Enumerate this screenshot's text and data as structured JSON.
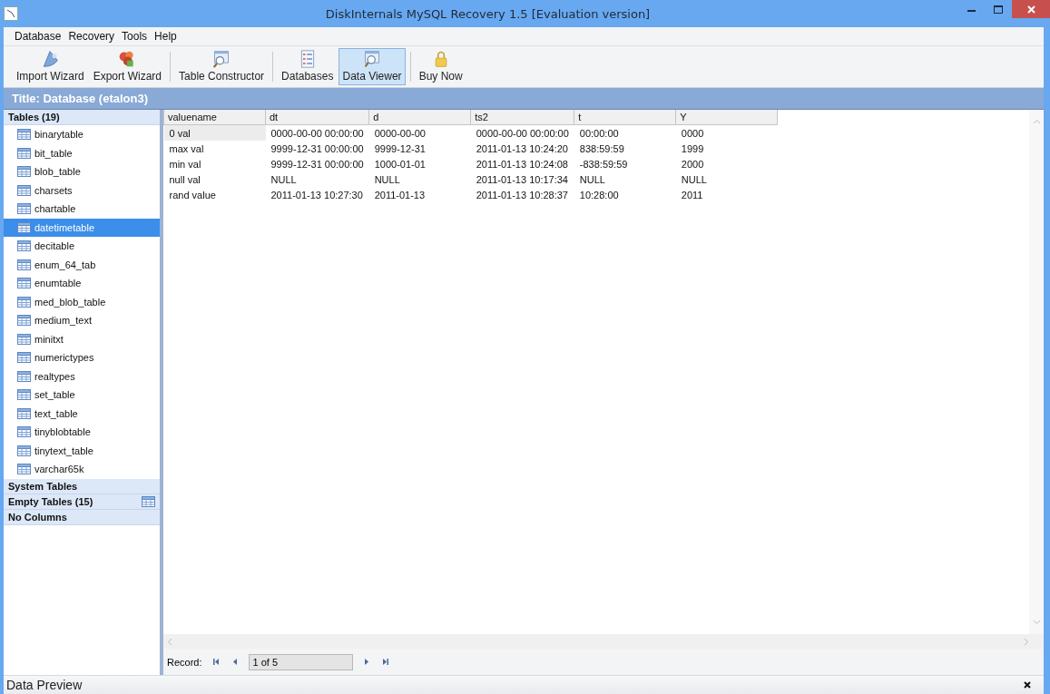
{
  "window": {
    "title": "DiskInternals MySQL Recovery 1.5 [Evaluation version]"
  },
  "menu": [
    "Database",
    "Recovery",
    "Tools",
    "Help"
  ],
  "toolbar": [
    {
      "label": "Import Wizard",
      "kind": "import",
      "selected": false,
      "separator_after": false
    },
    {
      "label": "Export Wizard",
      "kind": "export",
      "selected": false,
      "separator_after": true
    },
    {
      "label": "Table Constructor",
      "kind": "constructor",
      "selected": false,
      "separator_after": true
    },
    {
      "label": "Databases",
      "kind": "databases",
      "selected": false,
      "separator_after": false
    },
    {
      "label": "Data Viewer",
      "kind": "viewer",
      "selected": true,
      "separator_after": true
    },
    {
      "label": "Buy Now",
      "kind": "buy",
      "selected": false,
      "separator_after": false
    }
  ],
  "title_strip": "Title: Database (etalon3)",
  "sidebar": {
    "sections": [
      {
        "label": "Tables (19)",
        "table_icon": false,
        "items": [
          {
            "label": "binarytable",
            "selected": false
          },
          {
            "label": "bit_table",
            "selected": false
          },
          {
            "label": "blob_table",
            "selected": false
          },
          {
            "label": "charsets",
            "selected": false
          },
          {
            "label": "chartable",
            "selected": false
          },
          {
            "label": "datetimetable",
            "selected": true
          },
          {
            "label": "decitable",
            "selected": false
          },
          {
            "label": "enum_64_tab",
            "selected": false
          },
          {
            "label": "enumtable",
            "selected": false
          },
          {
            "label": "med_blob_table",
            "selected": false
          },
          {
            "label": "medium_text",
            "selected": false
          },
          {
            "label": "minitxt",
            "selected": false
          },
          {
            "label": "numerictypes",
            "selected": false
          },
          {
            "label": "realtypes",
            "selected": false
          },
          {
            "label": "set_table",
            "selected": false
          },
          {
            "label": "text_table",
            "selected": false
          },
          {
            "label": "tinyblobtable",
            "selected": false
          },
          {
            "label": "tinytext_table",
            "selected": false
          },
          {
            "label": "varchar65k",
            "selected": false
          }
        ]
      },
      {
        "label": "System Tables",
        "table_icon": false
      },
      {
        "label": "Empty Tables (15)",
        "table_icon": true
      },
      {
        "label": "No Columns",
        "table_icon": false
      }
    ]
  },
  "table": {
    "columns": [
      "valuename",
      "dt",
      "d",
      "ts2",
      "t",
      "Y"
    ],
    "rows": [
      {
        "selected": true,
        "cells": [
          "0 val",
          "0000-00-00 00:00:00",
          "0000-00-00",
          "0000-00-00 00:00:00",
          "00:00:00",
          "0000"
        ]
      },
      {
        "selected": false,
        "cells": [
          "max val",
          "9999-12-31 00:00:00",
          "9999-12-31",
          "2011-01-13 10:24:20",
          "838:59:59",
          "1999"
        ]
      },
      {
        "selected": false,
        "cells": [
          "min val",
          "9999-12-31 00:00:00",
          "1000-01-01",
          "2011-01-13 10:24:08",
          "-838:59:59",
          "2000"
        ]
      },
      {
        "selected": false,
        "cells": [
          "null val",
          "NULL",
          "NULL",
          "2011-01-13 10:17:34",
          "NULL",
          "NULL"
        ]
      },
      {
        "selected": false,
        "cells": [
          "rand value",
          "2011-01-13 10:27:30",
          "2011-01-13",
          "2011-01-13 10:28:37",
          "10:28:00",
          "2011"
        ]
      }
    ]
  },
  "record_nav": {
    "label": "Record:",
    "value": "1 of 5"
  },
  "preview_panel": {
    "title": "Data Preview"
  }
}
